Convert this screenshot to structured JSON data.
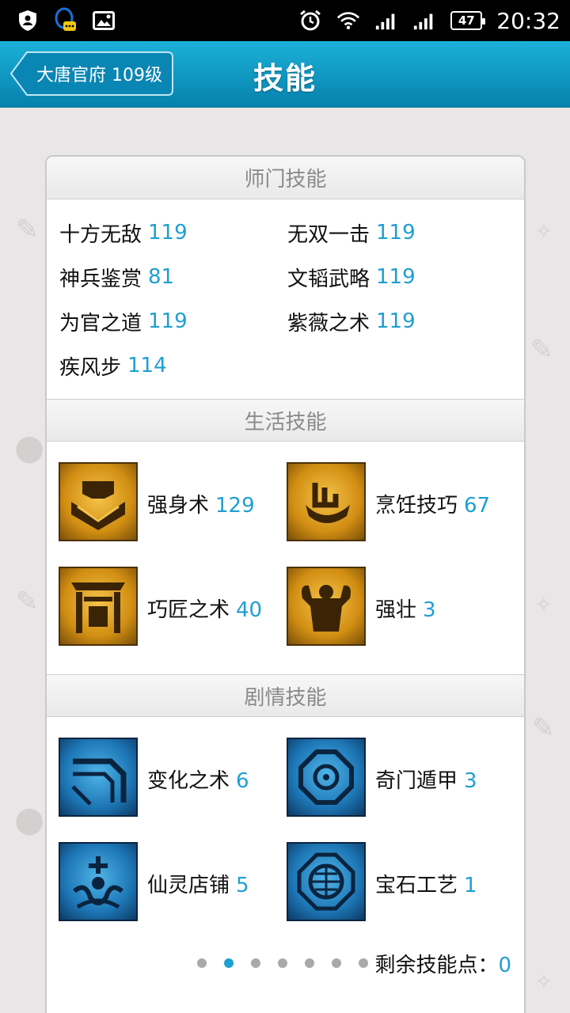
{
  "status_bar": {
    "battery": "47",
    "time": "20:32"
  },
  "header": {
    "back_label": "大唐官府 109级",
    "title": "技能"
  },
  "sections": {
    "school": {
      "title": "师门技能",
      "skills": [
        {
          "name": "十方无敌",
          "level": "119"
        },
        {
          "name": "无双一击",
          "level": "119"
        },
        {
          "name": "神兵鉴赏",
          "level": "81"
        },
        {
          "name": "文韬武略",
          "level": "119"
        },
        {
          "name": "为官之道",
          "level": "119"
        },
        {
          "name": "紫薇之术",
          "level": "119"
        },
        {
          "name": "疾风步",
          "level": "114"
        }
      ]
    },
    "life": {
      "title": "生活技能",
      "skills": [
        {
          "name": "强身术",
          "level": "129",
          "icon": "strength-icon"
        },
        {
          "name": "烹饪技巧",
          "level": "67",
          "icon": "cooking-icon"
        },
        {
          "name": "巧匠之术",
          "level": "40",
          "icon": "craftsman-icon"
        },
        {
          "name": "强壮",
          "level": "3",
          "icon": "muscle-icon"
        }
      ]
    },
    "story": {
      "title": "剧情技能",
      "skills": [
        {
          "name": "变化之术",
          "level": "6",
          "icon": "transform-icon"
        },
        {
          "name": "奇门遁甲",
          "level": "3",
          "icon": "qimen-icon"
        },
        {
          "name": "仙灵店铺",
          "level": "5",
          "icon": "shop-icon"
        },
        {
          "name": "宝石工艺",
          "level": "1",
          "icon": "gem-icon"
        }
      ]
    }
  },
  "pager": {
    "page_count": 7,
    "active_index": 1,
    "remaining_label": "剩余技能点：",
    "remaining_value": "0"
  },
  "colors": {
    "accent": "#1e9fd2",
    "header_top": "#1bb1d8",
    "header_bottom": "#0781ad"
  }
}
